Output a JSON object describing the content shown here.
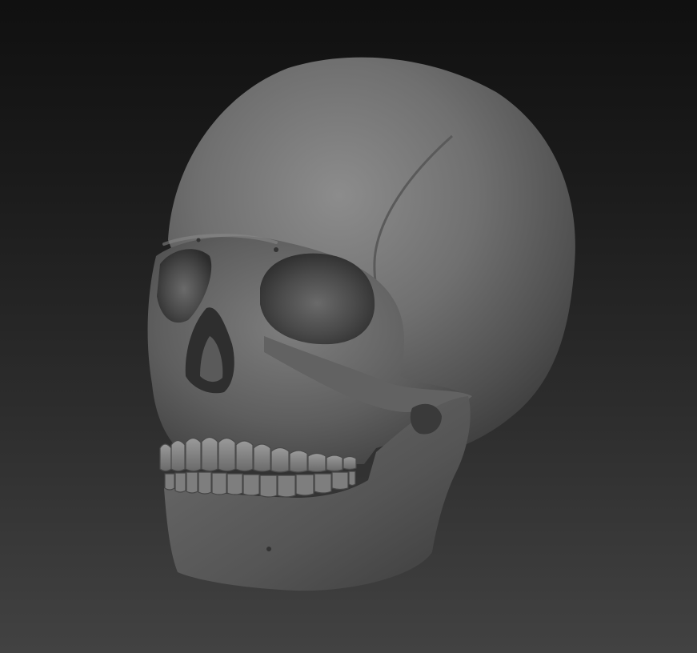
{
  "viewport": {
    "background_top": "#101010",
    "background_bottom": "#424242",
    "material_color": "#6e6e6e"
  },
  "model": {
    "subject": "skull-render",
    "parts": [
      "cranium",
      "eye-socket-left",
      "eye-socket-right",
      "nasal-cavity",
      "cheekbone",
      "jaw",
      "upper-teeth",
      "lower-teeth"
    ]
  }
}
